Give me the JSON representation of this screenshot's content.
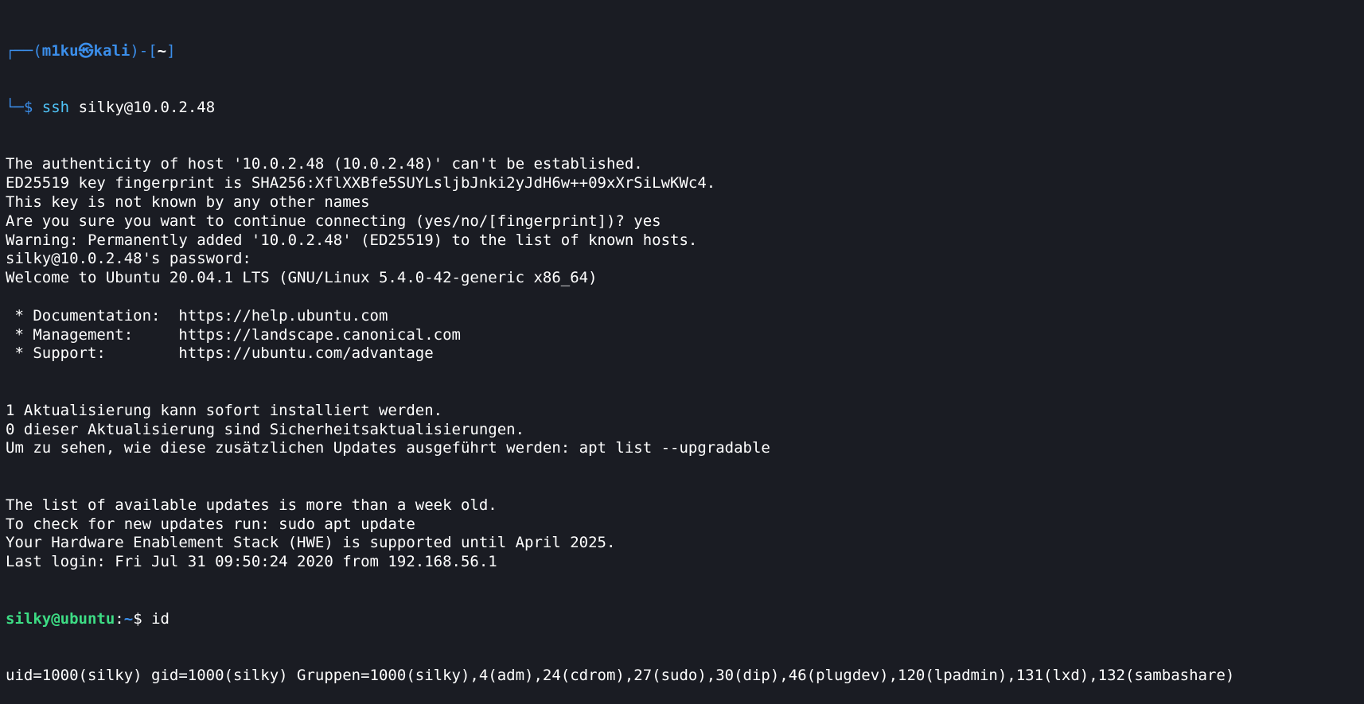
{
  "prompt_kali": {
    "frame_top_left": "┌──(",
    "user": "m1ku",
    "symbol": "㉿",
    "host": "kali",
    "sep": ")-[",
    "path": "~",
    "close": "]",
    "frame_bottom": "└─",
    "dollar": "$",
    "command": "ssh",
    "args": " silky@10.0.2.48"
  },
  "ssh_output": [
    "The authenticity of host '10.0.2.48 (10.0.2.48)' can't be established.",
    "ED25519 key fingerprint is SHA256:XflXXBfe5SUYLsljbJnki2yJdH6w++09xXrSiLwKWc4.",
    "This key is not known by any other names",
    "Are you sure you want to continue connecting (yes/no/[fingerprint])? yes",
    "Warning: Permanently added '10.0.2.48' (ED25519) to the list of known hosts.",
    "silky@10.0.2.48's password:",
    "Welcome to Ubuntu 20.04.1 LTS (GNU/Linux 5.4.0-42-generic x86_64)",
    "",
    " * Documentation:  https://help.ubuntu.com",
    " * Management:     https://landscape.canonical.com",
    " * Support:        https://ubuntu.com/advantage",
    "",
    "",
    "1 Aktualisierung kann sofort installiert werden.",
    "0 dieser Aktualisierung sind Sicherheitsaktualisierungen.",
    "Um zu sehen, wie diese zusätzlichen Updates ausgeführt werden: apt list --upgradable",
    "",
    "",
    "The list of available updates is more than a week old.",
    "To check for new updates run: sudo apt update",
    "Your Hardware Enablement Stack (HWE) is supported until April 2025.",
    "Last login: Fri Jul 31 09:50:24 2020 from 192.168.56.1"
  ],
  "prompt_ubuntu": {
    "user_host": "silky@ubuntu",
    "colon": ":",
    "path": "~",
    "dollar": "$",
    "command": " id"
  },
  "id_output": "uid=1000(silky) gid=1000(silky) Gruppen=1000(silky),4(adm),24(cdrom),27(sudo),30(dip),46(plugdev),120(lpadmin),131(lxd),132(sambashare)"
}
